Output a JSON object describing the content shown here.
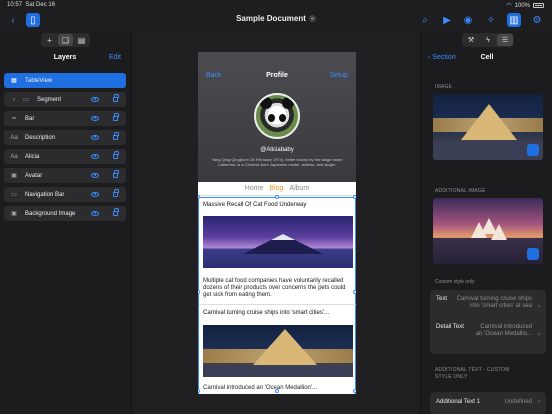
{
  "status": {
    "time": "10:57",
    "date": "Sat Dec 16",
    "battery": "100%"
  },
  "document": {
    "title": "Sample Document"
  },
  "layers_panel": {
    "title": "Layers",
    "edit_label": "Edit",
    "items": [
      {
        "label": "TableView",
        "icon": "table-icon",
        "selected": true
      },
      {
        "label": "Segment",
        "icon": "chevron-right-icon"
      },
      {
        "label": "Bar",
        "icon": "bar-icon"
      },
      {
        "label": "Description",
        "icon": "text-icon"
      },
      {
        "label": "Alicia",
        "icon": "text-icon"
      },
      {
        "label": "Avatar",
        "icon": "image-icon"
      },
      {
        "label": "Navigation Bar",
        "icon": "navbar-icon"
      },
      {
        "label": "Background Image",
        "icon": "image-icon"
      }
    ]
  },
  "device": {
    "back": "Back",
    "title": "Profile",
    "setup": "Setup",
    "username": "@Aliciababy",
    "bio": "Yang Qing Qing(born 28 February 1974), better known by her stage name Catherine, is a Chinese-born Japanese model, actress, and singer.",
    "segments": [
      "Home",
      "Blog",
      "Album"
    ],
    "active_segment": "Blog",
    "cells": [
      {
        "title": "Massive Recall Of Cat Food Underway",
        "body": "Multiple cat food companies have voluntarily recalled dozens of their products over concerns the pets could get sick from eating them."
      },
      {
        "title": "Carnival turning cruise ships into 'smart cities'...",
        "body": "Carnival introduced an 'Ocean Medallion'..."
      }
    ]
  },
  "inspector": {
    "back": "Section",
    "title": "Cell",
    "image_label": "IMAGE",
    "additional_image_label": "ADDITIONAL IMAGE",
    "custom_style_note": "Custom style only",
    "text_key": "Text",
    "text_value": "Carnival turning cruise ships into 'smart cities' at sea",
    "detail_key": "Detail Text",
    "detail_value": "Carnival introduced an 'Ocean Medallio...",
    "additional_text_label": "ADDITIONAL TEXT - CUSTOM STYLE ONLY",
    "additional_text_key": "Additional Text 1",
    "additional_text_value": "Undefined"
  }
}
